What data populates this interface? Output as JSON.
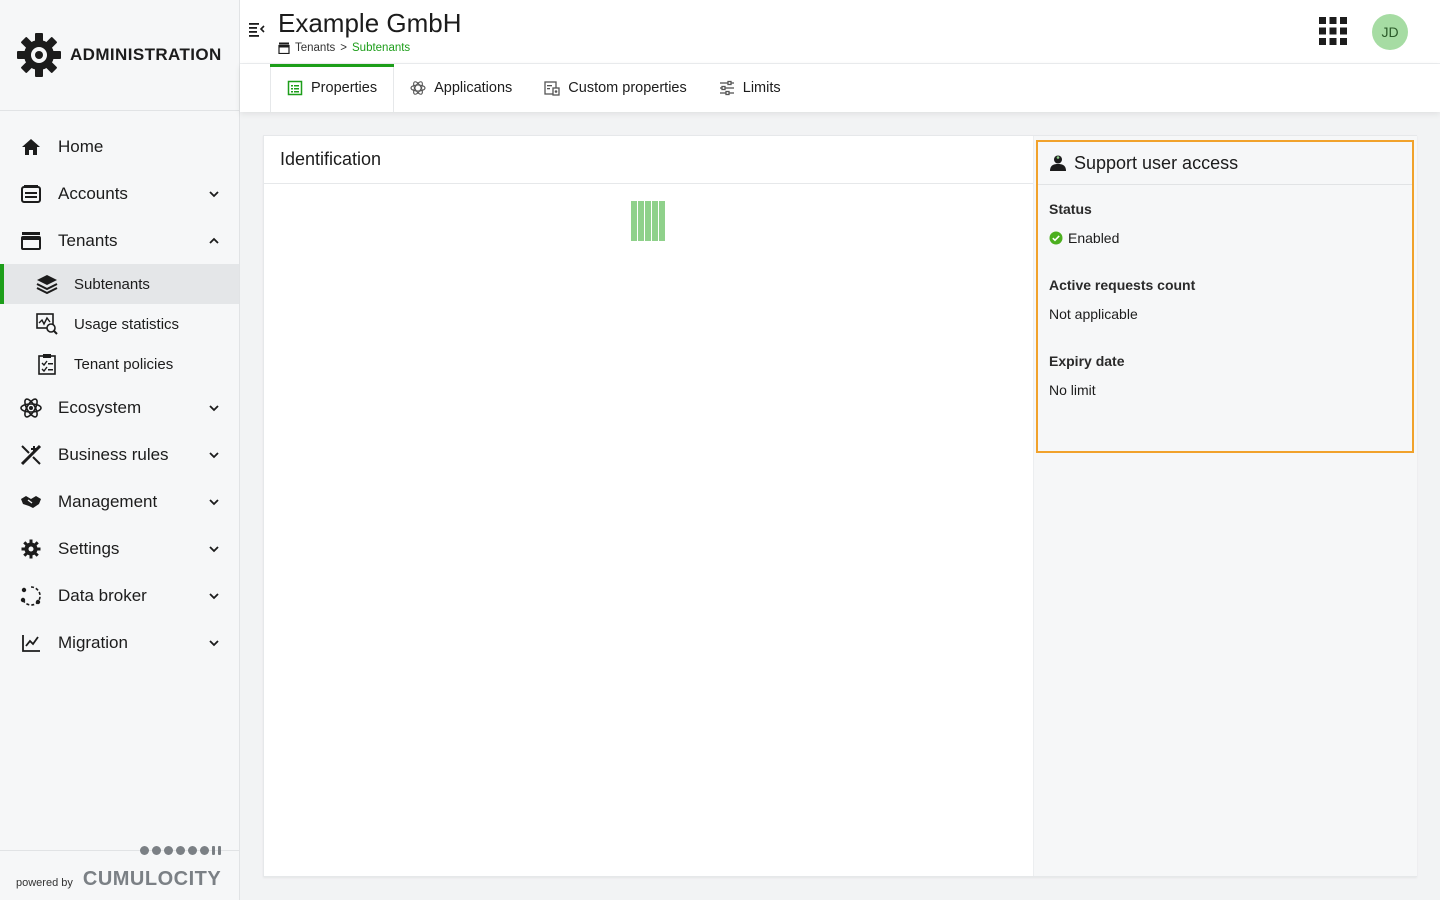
{
  "app": {
    "title": "ADMINISTRATION"
  },
  "sidebar": {
    "items": [
      {
        "label": "Home",
        "icon": "home-icon"
      },
      {
        "label": "Accounts",
        "icon": "accounts-icon"
      },
      {
        "label": "Tenants",
        "icon": "tenants-icon",
        "expanded": true,
        "children": [
          {
            "label": "Subtenants",
            "icon": "layers-icon",
            "active": true
          },
          {
            "label": "Usage statistics",
            "icon": "usage-statistics-icon"
          },
          {
            "label": "Tenant policies",
            "icon": "tenant-policies-icon"
          }
        ]
      },
      {
        "label": "Ecosystem",
        "icon": "ecosystem-icon"
      },
      {
        "label": "Business rules",
        "icon": "business-rules-icon"
      },
      {
        "label": "Management",
        "icon": "management-icon"
      },
      {
        "label": "Settings",
        "icon": "gear-icon"
      },
      {
        "label": "Data broker",
        "icon": "data-broker-icon"
      },
      {
        "label": "Migration",
        "icon": "migration-icon"
      }
    ],
    "powered_by": "powered by",
    "vendor": "CUMULOCITY"
  },
  "header": {
    "title": "Example GmbH",
    "breadcrumb": {
      "parent": "Tenants",
      "separator": ">",
      "current": "Subtenants"
    },
    "avatar_initials": "JD"
  },
  "tabs": [
    {
      "label": "Properties",
      "icon": "properties-icon",
      "active": true
    },
    {
      "label": "Applications",
      "icon": "applications-icon"
    },
    {
      "label": "Custom properties",
      "icon": "custom-properties-icon"
    },
    {
      "label": "Limits",
      "icon": "limits-icon"
    }
  ],
  "identification": {
    "title": "Identification"
  },
  "support_access": {
    "title": "Support user access",
    "fields": [
      {
        "label": "Status",
        "value": "Enabled",
        "status_icon": "check-circle-icon"
      },
      {
        "label": "Active requests count",
        "value": "Not applicable"
      },
      {
        "label": "Expiry date",
        "value": "No limit"
      }
    ]
  },
  "colors": {
    "accent": "#1d9e1a",
    "highlight": "#f1a22c",
    "avatar": "#a6dca3"
  }
}
